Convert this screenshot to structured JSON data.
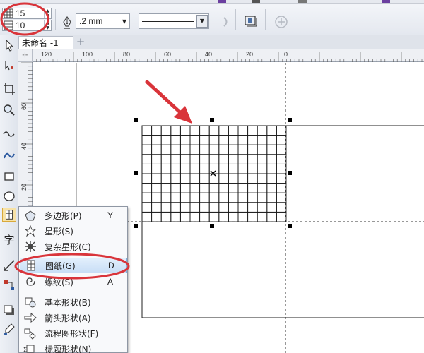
{
  "property_bar": {
    "columns_value": "15",
    "rows_value": "10",
    "outline_width": ".2 mm"
  },
  "document": {
    "tab_title": "未命名 -1",
    "add_tab_symbol": "+"
  },
  "ruler": {
    "corner_symbol": "⊹",
    "horizontal_ticks": [
      "120",
      "100",
      "80",
      "60",
      "40",
      "20",
      "0"
    ],
    "vertical_ticks": [
      "60",
      "40",
      "20"
    ]
  },
  "graph_paper": {
    "columns": 15,
    "rows": 10
  },
  "flyout": {
    "items": [
      {
        "label": "多边形(P)",
        "key": "Y",
        "icon": "polygon-icon"
      },
      {
        "label": "星形(S)",
        "key": "",
        "icon": "star-icon"
      },
      {
        "label": "复杂星形(C)",
        "key": "",
        "icon": "complex-star-icon"
      },
      {
        "label": "图纸(G)",
        "key": "D",
        "icon": "graph-paper-icon"
      },
      {
        "label": "螺纹(S)",
        "key": "A",
        "icon": "spiral-icon"
      },
      {
        "label": "基本形状(B)",
        "key": "",
        "icon": "basic-shapes-icon"
      },
      {
        "label": "箭头形状(A)",
        "key": "",
        "icon": "arrow-shapes-icon"
      },
      {
        "label": "流程图形状(F)",
        "key": "",
        "icon": "flowchart-shapes-icon"
      },
      {
        "label": "标题形状(N)",
        "key": "",
        "icon": "banner-shapes-icon"
      }
    ]
  },
  "colors": {
    "annotation_red": "#d9343a",
    "selected_item_bg": "#c8def6",
    "grid_line": "#1a1a1a"
  }
}
